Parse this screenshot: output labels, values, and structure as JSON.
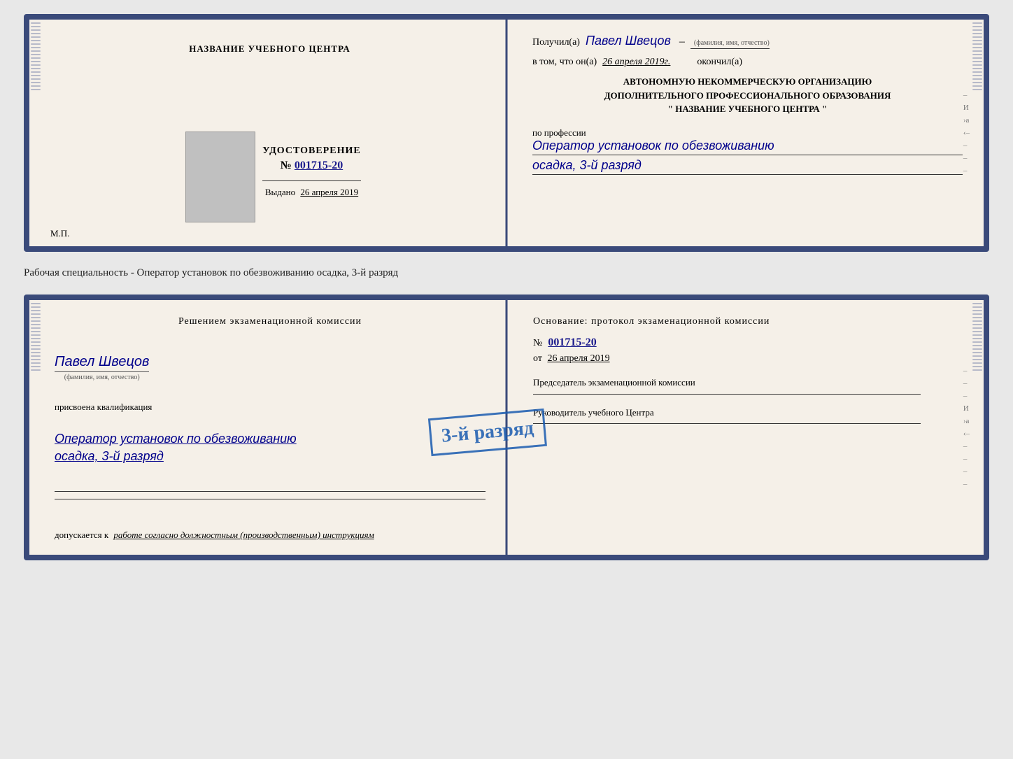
{
  "doc1": {
    "left": {
      "center_title": "НАЗВАНИЕ УЧЕБНОГО ЦЕНТРА",
      "cert_title": "УДОСТОВЕРЕНИЕ",
      "cert_number_prefix": "№",
      "cert_number": "001715-20",
      "issued_label": "Выдано",
      "issued_date": "26 апреля 2019",
      "mp_label": "М.П."
    },
    "right": {
      "received_label": "Получил(а)",
      "received_name": "Павел Швецов",
      "fio_label": "(фамилия, имя, отчество)",
      "in_that": "в том, что он(а)",
      "date_filled": "26 апреля 2019г.",
      "finished_label": "окончил(а)",
      "org_line1": "АВТОНОМНУЮ НЕКОММЕРЧЕСКУЮ ОРГАНИЗАЦИЮ",
      "org_line2": "ДОПОЛНИТЕЛЬНОГО ПРОФЕССИОНАЛЬНОГО ОБРАЗОВАНИЯ",
      "org_line3": "\"   НАЗВАНИЕ УЧЕБНОГО ЦЕНТРА   \"",
      "profession_label": "по профессии",
      "profession_name": "Оператор установок по обезвоживанию",
      "rank": "осадка, 3-й разряд"
    }
  },
  "caption": "Рабочая специальность - Оператор установок по обезвоживанию осадка, 3-й разряд",
  "doc2": {
    "left": {
      "decision_text": "Решением экзаменационной комиссии",
      "person_name": "Павел Швецов",
      "fio_label": "(фамилия, имя, отчество)",
      "assigned_text": "присвоена квалификация",
      "qualification": "Оператор установок по обезвоживанию",
      "rank": "осадка, 3-й разряд",
      "allowed_prefix": "допускается к",
      "allowed_text": "работе согласно должностным (производственным) инструкциям"
    },
    "right": {
      "basis_text": "Основание: протокол экзаменационной комиссии",
      "number_prefix": "№",
      "protocol_number": "001715-20",
      "from_label": "от",
      "from_date": "26 апреля 2019",
      "chairman_text": "Председатель экзаменационной комиссии",
      "head_text": "Руководитель учебного Центра"
    },
    "stamp_text": "3-й разряд"
  },
  "spine_count": 40
}
